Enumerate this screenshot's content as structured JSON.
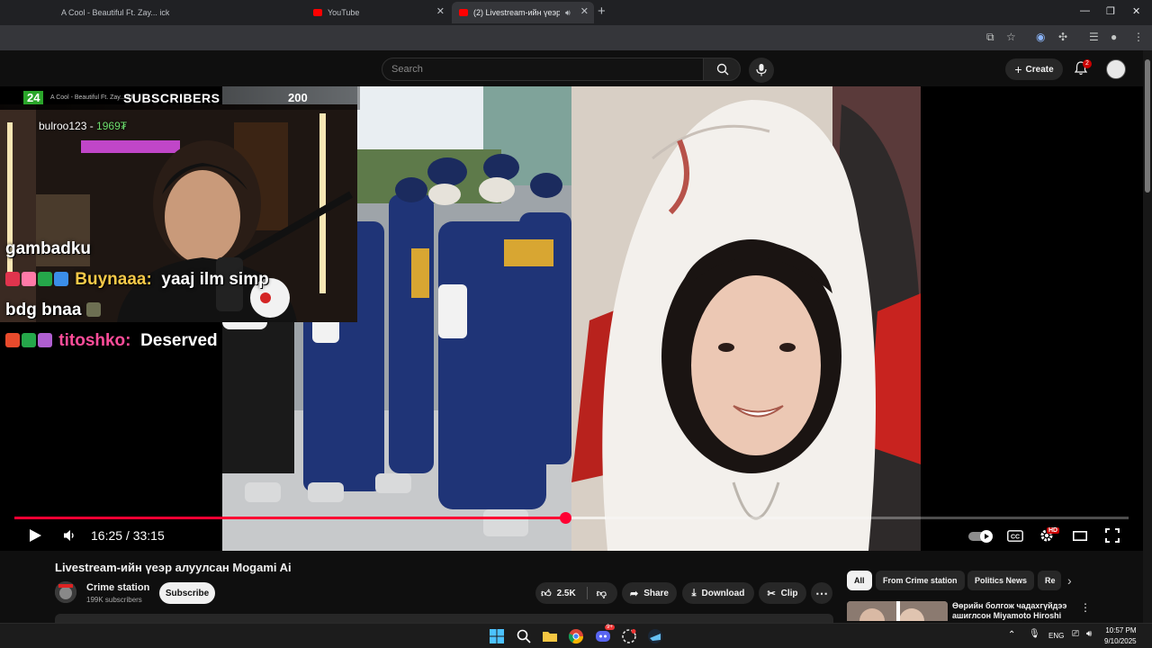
{
  "browser": {
    "tabs": [
      {
        "label": "A Cool - Beautiful Ft. Zay... ick",
        "active": false
      },
      {
        "label": "YouTube",
        "active": false
      },
      {
        "label": "(2) Livestream-ийн үеэр ал...",
        "active": true
      }
    ],
    "new_tab_label": "+",
    "window_controls": {
      "minimize": "—",
      "maximize": "❐",
      "close": "✕"
    }
  },
  "youtube": {
    "search": {
      "placeholder": "Search"
    },
    "create_label": "Create",
    "notifications_count": "2"
  },
  "stream_overlay": {
    "subs_counter_badge": "24",
    "subs_label": "SUBSCRIBERS",
    "subs_goal": "200",
    "now_playing": "A Cool - Beautiful Ft. Zay... ick",
    "donation": {
      "user": "bulroo123 - ",
      "amount": "1969₮"
    },
    "chat": [
      {
        "user": "",
        "message": "gambadku",
        "user_color": "none"
      },
      {
        "user": "Buynaaa:",
        "message": "yaaj ilm simp",
        "user_color": "#f7c948"
      },
      {
        "user": "",
        "message": "bdg bnaa",
        "user_color": "none"
      },
      {
        "user": "titoshko:",
        "message": "Deserved",
        "user_color": "#ff4d9a"
      }
    ]
  },
  "player": {
    "current_time": "16:25",
    "duration": "33:15",
    "time_display": "16:25 / 33:15",
    "progress_fraction": 0.494,
    "buffered_fraction": 0.531,
    "quality_badge": "HD"
  },
  "video": {
    "title": "Livestream-ийн үеэр алуулсан Mogami Ai",
    "channel": {
      "name": "Crime station",
      "subscribers": "199K subscribers"
    },
    "subscribe_label": "Subscribe",
    "likes": "2.5K",
    "share_label": "Share",
    "download_label": "Download",
    "clip_label": "Clip",
    "more_label": "⋯"
  },
  "related": {
    "chips": [
      {
        "label": "All",
        "selected": true
      },
      {
        "label": "From Crime station",
        "selected": false
      },
      {
        "label": "Politics News",
        "selected": false
      },
      {
        "label": "Re",
        "selected": false
      }
    ],
    "items": [
      {
        "title": "Өөрийн болгож чадахгүйдээ ашиглсон Miyamoto Hiroshi"
      }
    ]
  },
  "taskbar": {
    "language": "ENG",
    "time": "10:57 PM",
    "date": "9/10/2025",
    "discord_badge": "9+"
  },
  "colors": {
    "youtube_red": "#ff0033",
    "chat_yellow": "#f7c948",
    "chat_pink": "#ff4d9a"
  }
}
